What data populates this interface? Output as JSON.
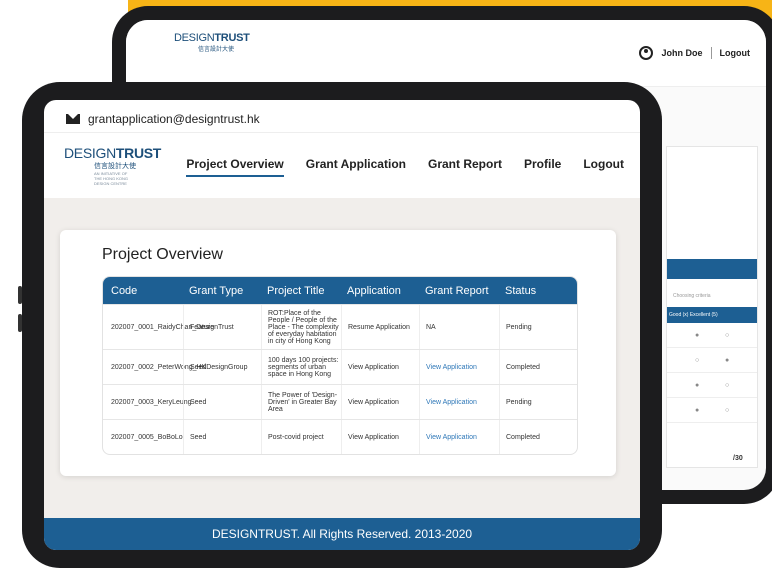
{
  "back": {
    "user_name": "John Doe",
    "logout": "Logout",
    "logo_main_a": "DESIGN",
    "logo_main_b": "TRUST",
    "logo_cn": "信言設計大使",
    "small_note": "Choosing criteria",
    "hdr2": "Good (x)  Excellent (5)",
    "total": "/30"
  },
  "front": {
    "email": "grantapplication@designtrust.hk",
    "logo_main_a": "DESIGN",
    "logo_main_b": "TRUST",
    "logo_cn": "信言設計大使",
    "logo_sub": "AN INITIATIVE OF THE HONG KONG DESIGN CENTRE",
    "nav": [
      "Project Overview",
      "Grant Application",
      "Grant Report",
      "Profile",
      "Logout"
    ],
    "page_title": "Project Overview",
    "columns": [
      "Code",
      "Grant Type",
      "Project Title",
      "Application",
      "Grant Report",
      "Status"
    ],
    "rows": [
      {
        "code": "202007_0001_RaidyChan_DesignTrust",
        "type": "Feature",
        "title": "ROT:Place of the People / People of the Place - The complexity of everyday habitation in city of Hong Kong",
        "application": "Resume Application",
        "report": "NA",
        "status": "Pending"
      },
      {
        "code": "202007_0002_PeterWong_HKDesignGroup",
        "type": "Seed",
        "title": "100 days 100 projects: segments of urban space in Hong Kong",
        "application": "View Application",
        "report": "View Application",
        "status": "Completed"
      },
      {
        "code": "202007_0003_KeryLeung",
        "type": "Seed",
        "title": "The Power of 'Design-Driven' in Greater Bay Area",
        "application": "View Application",
        "report": "View Application",
        "status": "Pending"
      },
      {
        "code": "202007_0005_BoBoLo",
        "type": "Seed",
        "title": "Post-covid project",
        "application": "View Application",
        "report": "View Application",
        "status": "Completed"
      }
    ],
    "footer": "DESIGNTRUST. All Rights Reserved. 2013-2020"
  }
}
